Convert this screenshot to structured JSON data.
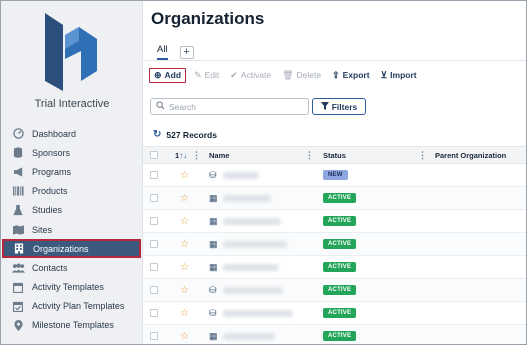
{
  "sidebar": {
    "brand": "Trial Interactive",
    "items": [
      {
        "label": "Dashboard",
        "icon": "dashboard-icon",
        "active": false
      },
      {
        "label": "Sponsors",
        "icon": "database-icon",
        "active": false
      },
      {
        "label": "Programs",
        "icon": "megaphone-icon",
        "active": false
      },
      {
        "label": "Products",
        "icon": "barcode-icon",
        "active": false
      },
      {
        "label": "Studies",
        "icon": "flask-icon",
        "active": false
      },
      {
        "label": "Sites",
        "icon": "map-icon",
        "active": false
      },
      {
        "label": "Organizations",
        "icon": "building-icon",
        "active": true
      },
      {
        "label": "Contacts",
        "icon": "users-icon",
        "active": false
      },
      {
        "label": "Activity Templates",
        "icon": "calendar-icon",
        "active": false
      },
      {
        "label": "Activity Plan Templates",
        "icon": "calendar-check-icon",
        "active": false
      },
      {
        "label": "Milestone Templates",
        "icon": "map-pin-icon",
        "active": false
      }
    ]
  },
  "main": {
    "title": "Organizations",
    "tabs": [
      {
        "label": "All"
      }
    ],
    "add_tab": "+",
    "toolbar": {
      "add": "Add",
      "edit": "Edit",
      "activate": "Activate",
      "delete": "Delete",
      "export": "Export",
      "import": "Import"
    },
    "search_placeholder": "Search",
    "filters_label": "Filters",
    "records_text": "527 Records",
    "table": {
      "headers": {
        "sort": "1",
        "name": "Name",
        "status": "Status",
        "parent": "Parent Organization"
      },
      "rows": [
        {
          "status": "NEW",
          "icon": "database-icon"
        },
        {
          "status": "ACTIVE",
          "icon": "building-icon"
        },
        {
          "status": "ACTIVE",
          "icon": "building-icon"
        },
        {
          "status": "ACTIVE",
          "icon": "building-icon"
        },
        {
          "status": "ACTIVE",
          "icon": "building-icon"
        },
        {
          "status": "ACTIVE",
          "icon": "database-icon"
        },
        {
          "status": "ACTIVE",
          "icon": "database-icon"
        },
        {
          "status": "ACTIVE",
          "icon": "building-icon"
        }
      ]
    }
  },
  "colors": {
    "accent": "#2c5c9b",
    "active_nav": "#3c5a7e",
    "highlight_border": "#b3283d",
    "status_active": "#23a55a",
    "status_new": "#8ea7e0"
  }
}
